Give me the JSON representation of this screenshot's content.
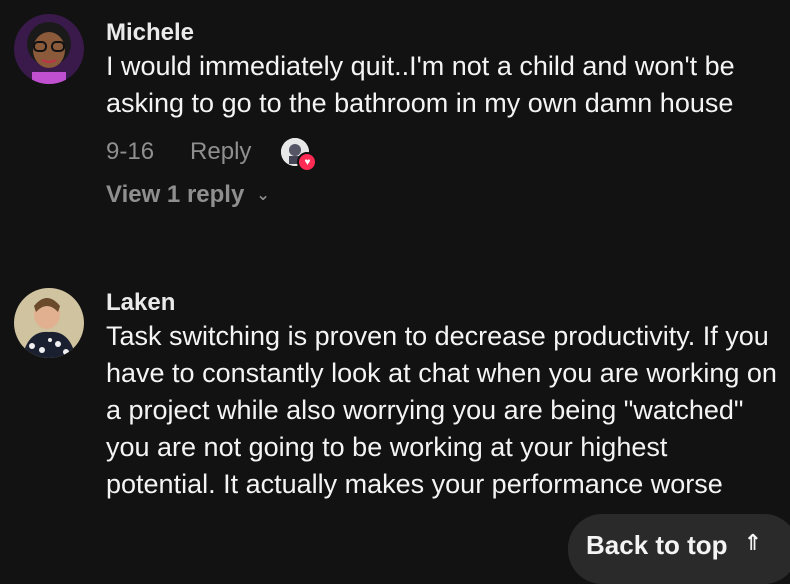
{
  "comments": [
    {
      "author": "Michele",
      "text": "I would immediately quit..I'm not a child and won't be asking to go to the bathroom in my own damn house",
      "date": "9-16",
      "reply_label": "Reply",
      "view_replies_label": "View 1 reply",
      "liked_avatar_icon": "creator-liked-avatar-icon"
    },
    {
      "author": "Laken",
      "text": "Task switching is proven to decrease productivity. If you have to constantly look at chat when you are working on a project while also worrying you are being \"watched\" you are not going to be working at your highest potential. It actually makes your performance worse"
    }
  ],
  "back_to_top_label": "Back to top",
  "colors": {
    "background": "#121212",
    "muted": "#8f8f8f",
    "heart": "#fe2c55"
  }
}
